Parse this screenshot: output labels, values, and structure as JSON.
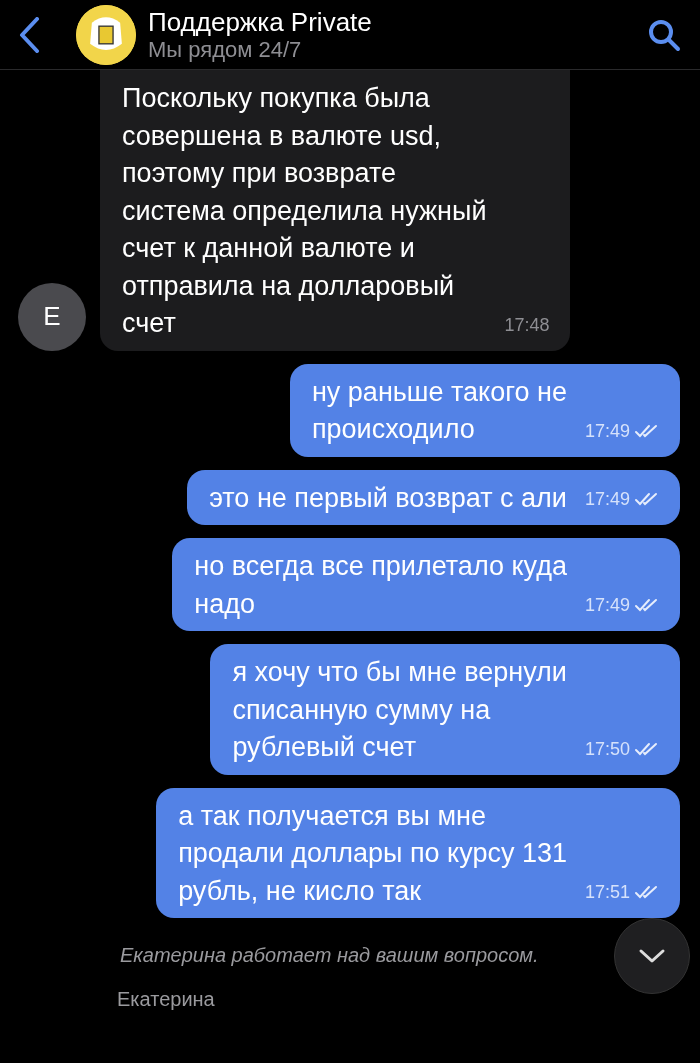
{
  "header": {
    "title": "Поддержка Private",
    "subtitle": "Мы рядом 24/7"
  },
  "messages": [
    {
      "kind": "incoming",
      "avatar": "E",
      "text": "Поскольку покупка была\nсовершена в валюте usd,\nпоэтому при возврате\nсистема определила нужный\nсчет к данной валюте и\nотправила на долларовый\nсчет",
      "time": "17:48"
    },
    {
      "kind": "outgoing",
      "text": "ну раньше такого не\nпроисходило",
      "time": "17:49",
      "read": true
    },
    {
      "kind": "outgoing",
      "text": "это не первый возврат с али",
      "time": "17:49",
      "read": true
    },
    {
      "kind": "outgoing",
      "text": "но всегда все прилетало куда\nнадо",
      "time": "17:49",
      "read": true
    },
    {
      "kind": "outgoing",
      "text": "я хочу что бы мне вернули\nсписанную сумму на\nрублевый счет",
      "time": "17:50",
      "read": true
    },
    {
      "kind": "outgoing",
      "text": "а так получается вы мне\nпродали доллары по курсу 131\nрубль, не кисло так",
      "time": "17:51",
      "read": true
    }
  ],
  "typing": "Екатерина работает над вашим вопросом.",
  "operator": "Екатерина"
}
